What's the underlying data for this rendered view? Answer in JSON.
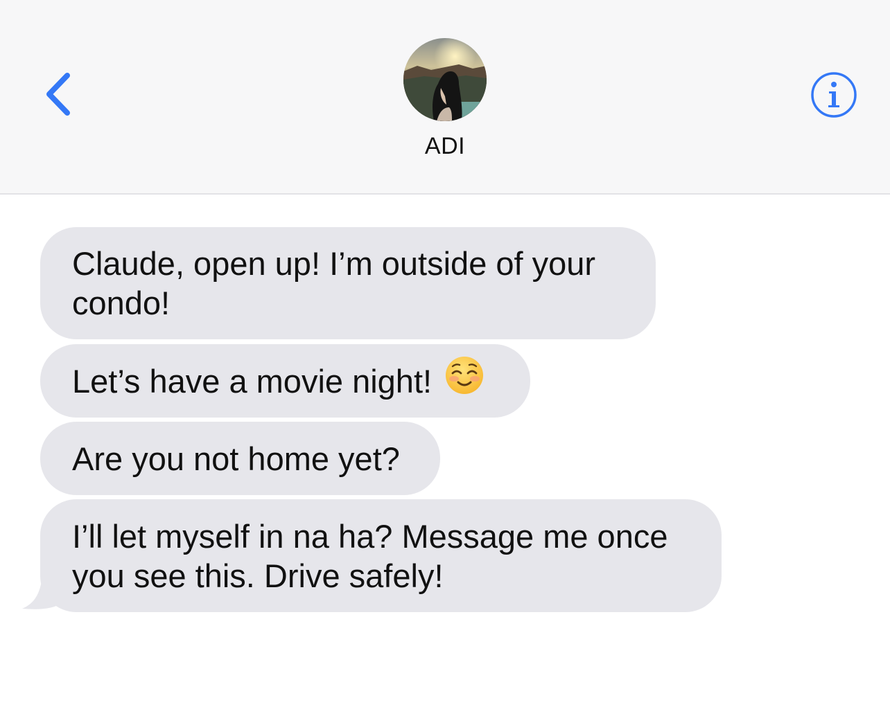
{
  "header": {
    "back_icon": "chevron-left-icon",
    "contact_name": "ADI",
    "info_icon": "info-icon",
    "accent_color": "#3478f6"
  },
  "messages": [
    {
      "text": "Claude, open up! I’m outside of your\ncondo!",
      "direction": "incoming"
    },
    {
      "text": "Let’s have a movie night!",
      "emoji": "smiling-face-icon",
      "direction": "incoming"
    },
    {
      "text": "Are you not home yet?",
      "direction": "incoming"
    },
    {
      "text": "I’ll let myself in na ha? Message me once\nyou see this. Drive safely!",
      "direction": "incoming"
    }
  ],
  "colors": {
    "header_bg": "#f7f7f8",
    "bubble_incoming": "#e6e6eb",
    "text": "#111111"
  }
}
